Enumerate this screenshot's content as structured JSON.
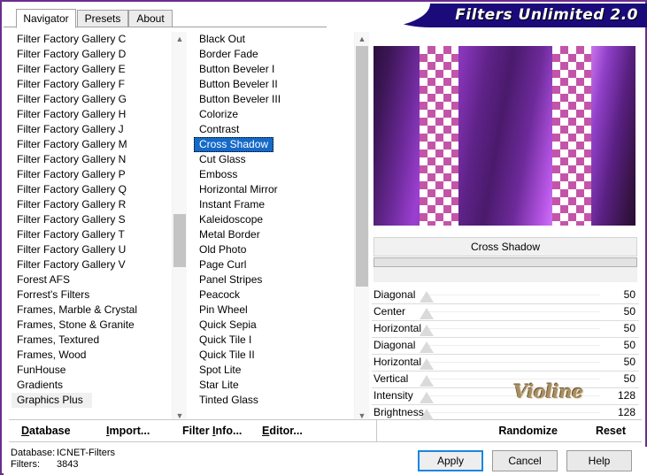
{
  "window": {
    "title": "Filters Unlimited 2.0"
  },
  "tabs": [
    {
      "label": "Navigator",
      "active": true
    },
    {
      "label": "Presets",
      "active": false
    },
    {
      "label": "About",
      "active": false
    }
  ],
  "category_list": {
    "items": [
      {
        "label": "Filter Factory Gallery C"
      },
      {
        "label": "Filter Factory Gallery D"
      },
      {
        "label": "Filter Factory Gallery E"
      },
      {
        "label": "Filter Factory Gallery F"
      },
      {
        "label": "Filter Factory Gallery G"
      },
      {
        "label": "Filter Factory Gallery H"
      },
      {
        "label": "Filter Factory Gallery J"
      },
      {
        "label": "Filter Factory Gallery M"
      },
      {
        "label": "Filter Factory Gallery N"
      },
      {
        "label": "Filter Factory Gallery P"
      },
      {
        "label": "Filter Factory Gallery Q"
      },
      {
        "label": "Filter Factory Gallery R"
      },
      {
        "label": "Filter Factory Gallery S"
      },
      {
        "label": "Filter Factory Gallery T"
      },
      {
        "label": "Filter Factory Gallery U"
      },
      {
        "label": "Filter Factory Gallery V"
      },
      {
        "label": "Forest AFS"
      },
      {
        "label": "Forrest's Filters"
      },
      {
        "label": "Frames, Marble & Crystal"
      },
      {
        "label": "Frames, Stone & Granite"
      },
      {
        "label": "Frames, Textured"
      },
      {
        "label": "Frames, Wood"
      },
      {
        "label": "FunHouse"
      },
      {
        "label": "Gradients"
      },
      {
        "label": "Graphics Plus",
        "hovered": true
      }
    ],
    "scroll_up_icon": "chevron-up-icon",
    "scroll_down_icon": "chevron-down-icon"
  },
  "filter_list": {
    "items": [
      {
        "label": "Black Out"
      },
      {
        "label": "Border Fade"
      },
      {
        "label": "Button Beveler I"
      },
      {
        "label": "Button Beveler II"
      },
      {
        "label": "Button Beveler III"
      },
      {
        "label": "Colorize"
      },
      {
        "label": "Contrast"
      },
      {
        "label": "Cross Shadow",
        "selected": true
      },
      {
        "label": "Cut Glass"
      },
      {
        "label": "Emboss"
      },
      {
        "label": "Horizontal Mirror"
      },
      {
        "label": "Instant Frame"
      },
      {
        "label": "Kaleidoscope"
      },
      {
        "label": "Metal Border"
      },
      {
        "label": "Old Photo"
      },
      {
        "label": "Page Curl"
      },
      {
        "label": "Panel Stripes"
      },
      {
        "label": "Peacock"
      },
      {
        "label": "Pin Wheel"
      },
      {
        "label": "Quick Sepia"
      },
      {
        "label": "Quick Tile I"
      },
      {
        "label": "Quick Tile II"
      },
      {
        "label": "Spot Lite"
      },
      {
        "label": "Star Lite"
      },
      {
        "label": "Tinted Glass"
      }
    ],
    "scroll_up_icon": "chevron-up-icon",
    "scroll_down_icon": "chevron-down-icon"
  },
  "preview": {
    "alt": "purple gradient with checkerboard stripes"
  },
  "filter_header": {
    "name": "Cross Shadow"
  },
  "parameters": [
    {
      "label": "Diagonal",
      "value": "50",
      "thumb_pct": 50
    },
    {
      "label": "Center",
      "value": "50",
      "thumb_pct": 50
    },
    {
      "label": "Horizontal",
      "value": "50",
      "thumb_pct": 50
    },
    {
      "label": "Diagonal",
      "value": "50",
      "thumb_pct": 50
    },
    {
      "label": "Horizontal",
      "value": "50",
      "thumb_pct": 50
    },
    {
      "label": "Vertical",
      "value": "50",
      "thumb_pct": 50
    },
    {
      "label": "Intensity",
      "value": "128",
      "thumb_pct": 50
    },
    {
      "label": "Brightness",
      "value": "128",
      "thumb_pct": 50
    }
  ],
  "watermark": {
    "text": "Violine"
  },
  "command_bar": {
    "buttons": [
      {
        "label": "Database",
        "accel": "D"
      },
      {
        "label": "Import...",
        "accel": "I"
      },
      {
        "label": "Filter Info...",
        "accel": "I"
      },
      {
        "label": "Editor...",
        "accel": "E"
      },
      {
        "label": "Randomize",
        "accel": ""
      },
      {
        "label": "Reset",
        "accel": ""
      }
    ]
  },
  "status": {
    "database_label": "Database:",
    "database_value": "ICNET-Filters",
    "filters_label": "Filters:",
    "filters_value": "3843"
  },
  "dialog_buttons": {
    "apply": "Apply",
    "cancel": "Cancel",
    "help": "Help"
  },
  "colors": {
    "frame": "#6b2d8f",
    "title_bg": "#1b0b7a",
    "selection": "#1569c7",
    "default_button_border": "#1b86e0"
  }
}
